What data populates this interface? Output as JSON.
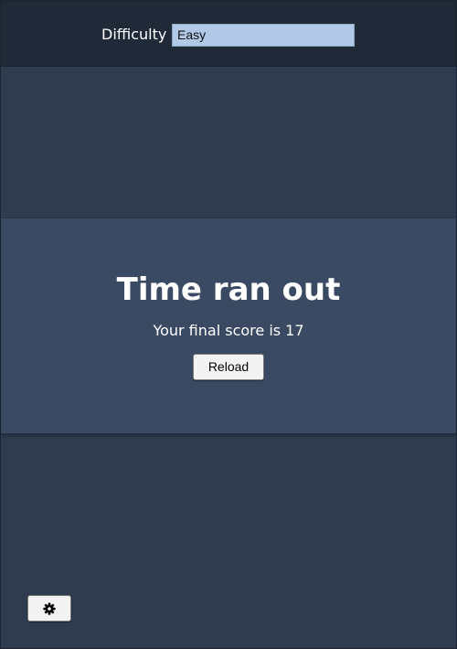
{
  "header": {
    "difficulty_label": "Difficulty",
    "difficulty_value": "Easy"
  },
  "game_over": {
    "title": "Time ran out",
    "score_text": "Your final score is 17",
    "reload_label": "Reload"
  },
  "settings": {
    "icon": "gear-icon"
  },
  "colors": {
    "background": "#2f3b4e",
    "top_bar": "#1f2938",
    "modal": "#3a4a63",
    "select_bg": "#b1c8e6"
  }
}
